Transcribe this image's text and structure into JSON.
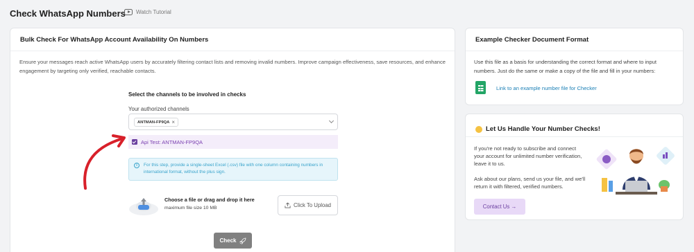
{
  "page": {
    "title": "Check WhatsApp Numbers",
    "watch_tutorial": "Watch Tutorial"
  },
  "main_card": {
    "heading": "Bulk Check For WhatsApp Account Availability On Numbers",
    "description": "Ensure your messages reach active WhatsApp users by accurately filtering contact lists and removing invalid numbers. Improve campaign effectiveness, save resources, and enhance engagement by targeting only verified, reachable contacts.",
    "select_title": "Select the channels to be involved in checks",
    "field_label": "Your authorized channels",
    "selected_chip": "ANTMAN-FP9QA",
    "chip_remove": "×",
    "dropdown_option": "Api Test: ANTMAN-FP9QA",
    "info_icon": "i",
    "info_text": "For this step, provide a single-sheet Excel (.csv) file with one column containing numbers in international format, without the plus sign.",
    "upload_title": "Choose a file or drag and drop it here",
    "upload_subtitle": "maximum file size 10 MB",
    "upload_button": "Click To Upload",
    "check_button": "Check"
  },
  "example_card": {
    "heading": "Example Checker Document Format",
    "description": "Use this file as a basis for understanding the correct format and where to input numbers. Just do the same or make a copy of the file and fill in your numbers:",
    "link": "Link to an example number file for Checker"
  },
  "handle_card": {
    "heading": "Let Us Handle Your Number Checks!",
    "paragraph1": "If you're not ready to subscribe and connect your account for unlimited number verification, leave it to us.",
    "paragraph2": "Ask about our plans, send us your file, and we'll return it with filtered, verified numbers.",
    "contact_button": "Contact Us →"
  },
  "colors": {
    "accent_purple": "#6b3fa0",
    "link_blue": "#1a7fb5",
    "info_blue": "#38a3cb",
    "check_button_gray": "#808080",
    "arrow_red": "#d8202a"
  },
  "icons": [
    "play-icon",
    "chevron-down-icon",
    "checkbox-checked-icon",
    "info-icon",
    "cloud-upload-icon",
    "upload-icon",
    "rocket-icon",
    "spreadsheet-icon",
    "waving-hand-icon"
  ]
}
